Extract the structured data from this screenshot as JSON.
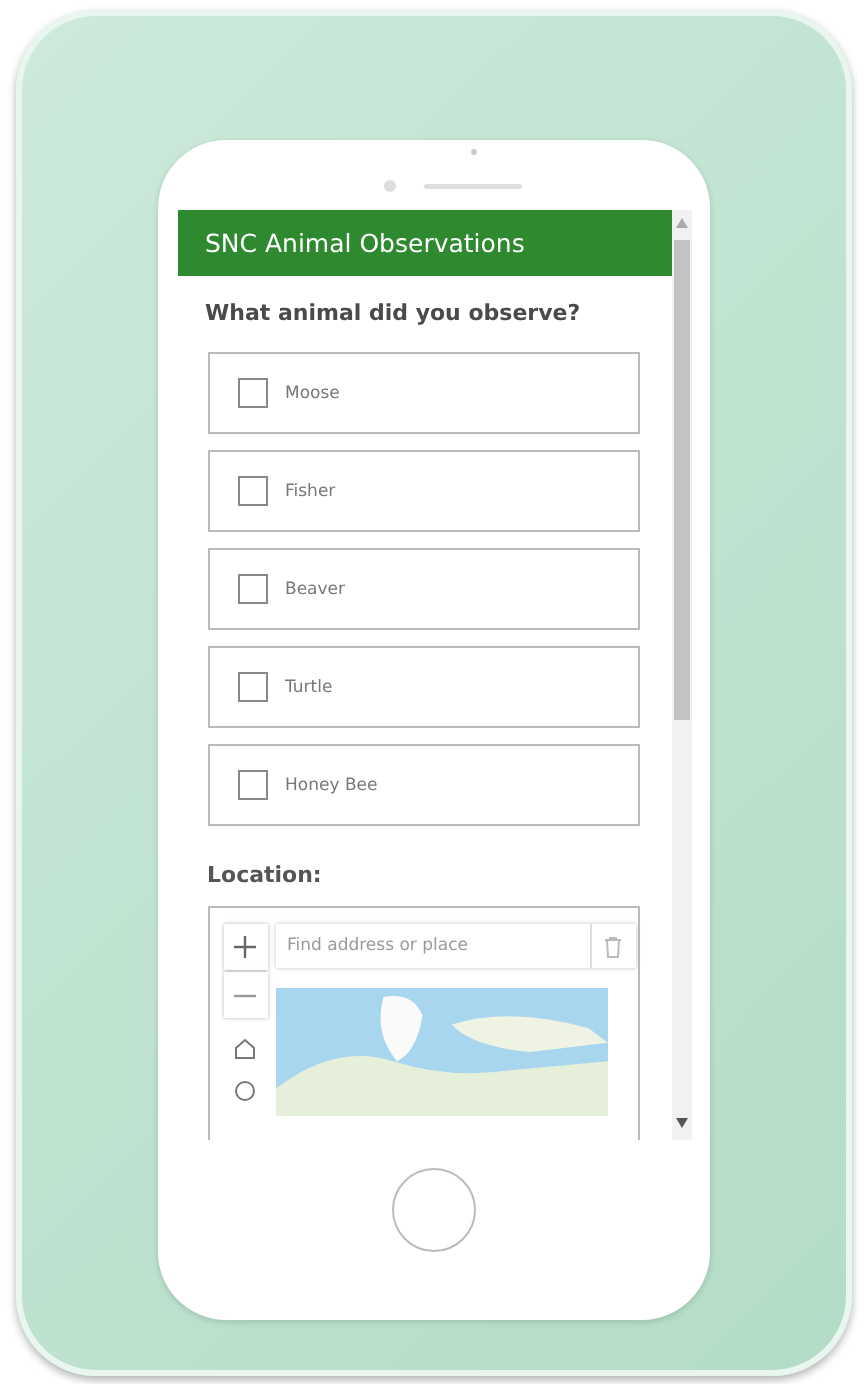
{
  "app": {
    "title": "SNC Animal Observations"
  },
  "question": {
    "label": "What animal did you observe?",
    "options": [
      {
        "label": "Moose",
        "checked": false
      },
      {
        "label": "Fisher",
        "checked": false
      },
      {
        "label": "Beaver",
        "checked": false
      },
      {
        "label": "Turtle",
        "checked": false
      },
      {
        "label": "Honey Bee",
        "checked": false
      }
    ]
  },
  "location": {
    "label": "Location:",
    "search": {
      "placeholder": "Find address or place"
    }
  }
}
